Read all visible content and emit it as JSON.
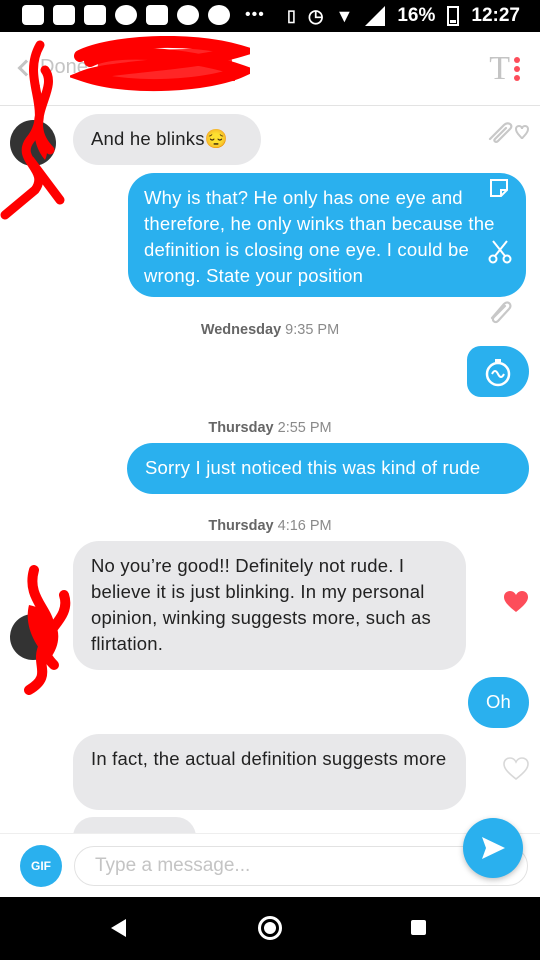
{
  "status_bar": {
    "battery": "16%",
    "time": "12:27"
  },
  "header": {
    "back_label": "Done",
    "toolbar_icon": "text-format-icon"
  },
  "timestamps": [
    {
      "day": "Wednesday",
      "time": "9:35 PM"
    },
    {
      "day": "Thursday",
      "time": "2:55 PM"
    },
    {
      "day": "Thursday",
      "time": "4:16 PM"
    }
  ],
  "messages": [
    {
      "direction": "incoming",
      "text": "And he blinks😔"
    },
    {
      "direction": "outgoing",
      "text": "Why is that? He only has one eye and therefore, he only winks than because the definition is closing one eye. I could be wrong. State your position"
    },
    {
      "direction": "outgoing",
      "text": "",
      "icon": "stopwatch-icon"
    },
    {
      "direction": "outgoing",
      "text": "Sorry I just noticed this was kind of rude"
    },
    {
      "direction": "incoming",
      "text": "No you’re good!! Definitely not rude. I believe it is just blinking. In my personal opinion, winking suggests more, such as flirtation.",
      "liked": true
    },
    {
      "direction": "outgoing",
      "text": "Oh"
    },
    {
      "direction": "incoming",
      "text": "In fact, the actual definition suggests more",
      "liked": false
    }
  ],
  "compose": {
    "gif_label": "GIF",
    "placeholder": "Type a message..."
  },
  "colors": {
    "accent": "#2ab0ee",
    "incoming_bubble": "#e8e8ea",
    "like_red": "#fd4d5a"
  }
}
